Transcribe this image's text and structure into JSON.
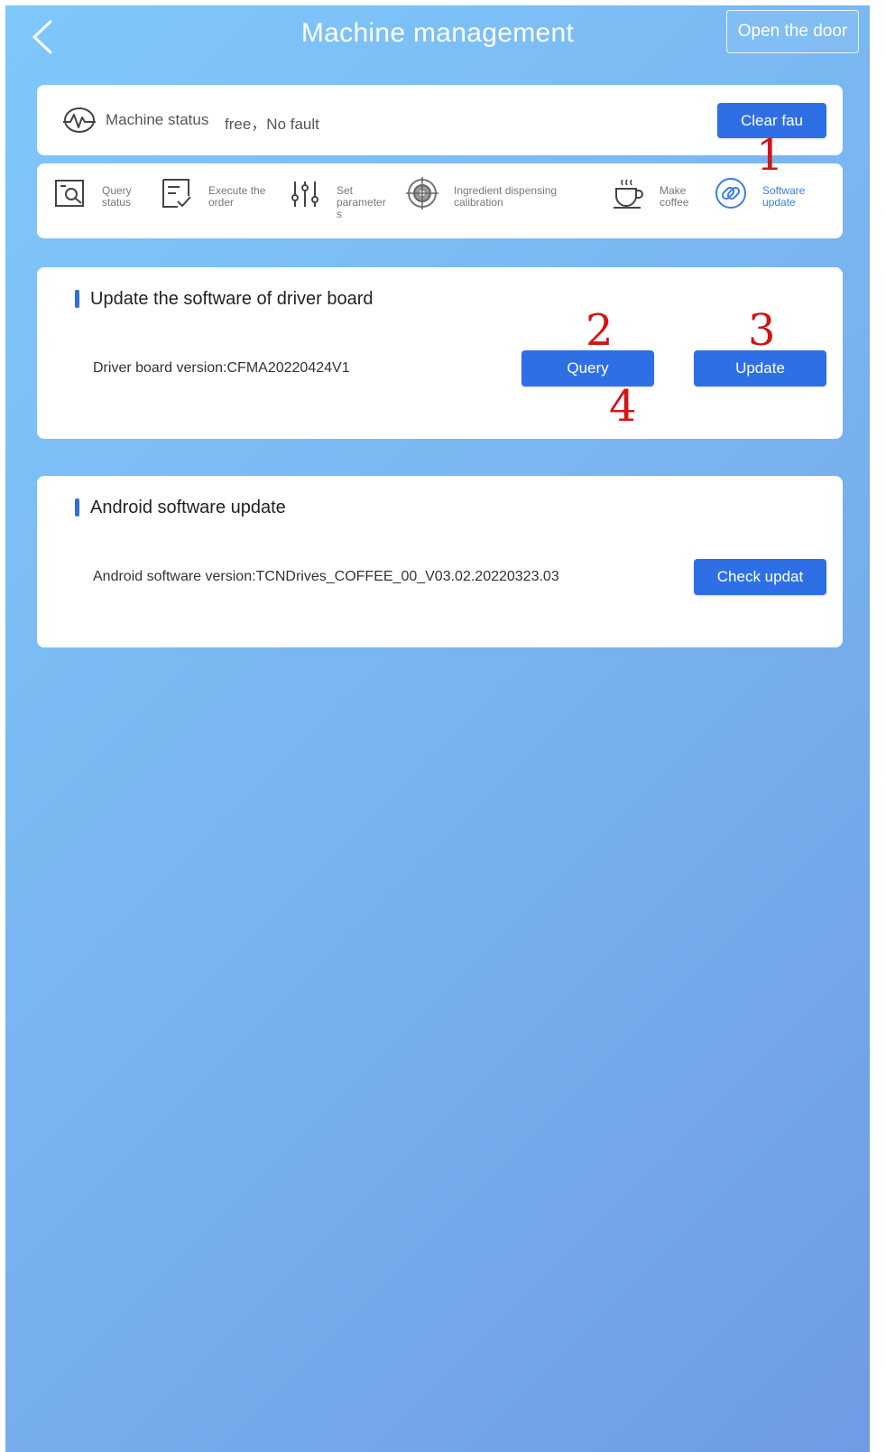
{
  "header": {
    "title": "Machine management",
    "open_door_label": "Open the door"
  },
  "status": {
    "label": "Machine status",
    "value": "free，No fault",
    "clear_button": "Clear fau"
  },
  "nav": {
    "items": [
      {
        "label_line1": "Query",
        "label_line2": "status",
        "label_line3": "",
        "icon": "query-status-icon",
        "active": false
      },
      {
        "label_line1": "Execute the",
        "label_line2": "order",
        "label_line3": "",
        "icon": "execute-order-icon",
        "active": false
      },
      {
        "label_line1": "Set",
        "label_line2": "parameter",
        "label_line3": "s",
        "icon": "sliders-icon",
        "active": false
      },
      {
        "label_line1": "Ingredient dispensing",
        "label_line2": "calibration",
        "label_line3": "",
        "icon": "target-icon",
        "active": false
      },
      {
        "label_line1": "Make",
        "label_line2": "coffee",
        "label_line3": "",
        "icon": "coffee-cup-icon",
        "active": false
      },
      {
        "label_line1": "Software",
        "label_line2": "update",
        "label_line3": "",
        "icon": "link-icon",
        "active": true
      }
    ]
  },
  "driver_section": {
    "title": "Update the software of driver board",
    "version_text": "Driver board version:CFMA20220424V1",
    "query_button": "Query",
    "update_button": "Update"
  },
  "android_section": {
    "title": "Android software update",
    "version_text": "Android software version:TCNDrives_COFFEE_00_V03.02.20220323.03",
    "check_button": "Check updat"
  },
  "annotations": [
    "1",
    "2",
    "3",
    "4"
  ],
  "colors": {
    "accent": "#2f6fe6",
    "annotation": "#d01616",
    "background_top": "#7fc8fa",
    "background_bottom": "#6f9be3"
  }
}
